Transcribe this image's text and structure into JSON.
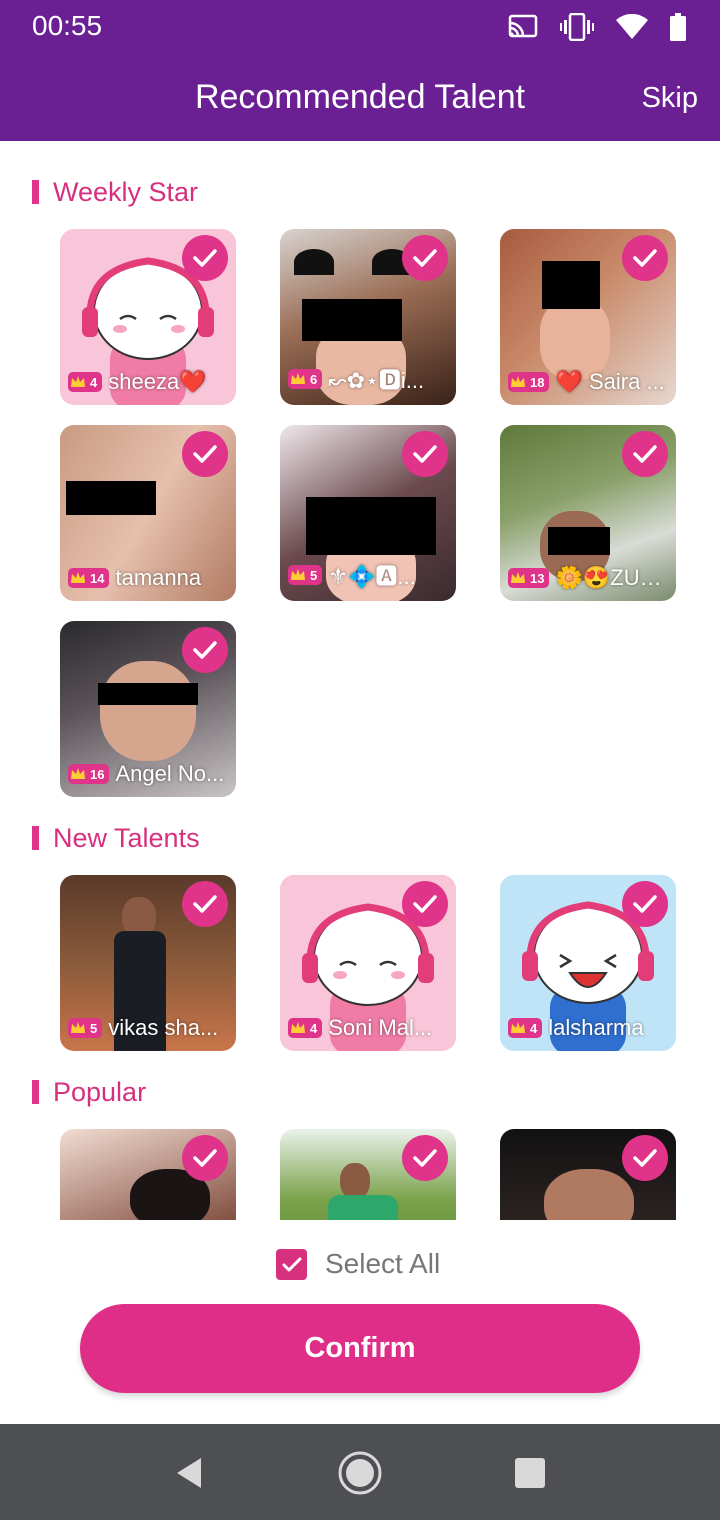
{
  "status": {
    "time": "00:55",
    "icons": [
      "cast-icon",
      "vibrate-icon",
      "wifi-icon",
      "battery-icon"
    ]
  },
  "header": {
    "title": "Recommended Talent",
    "skip": "Skip"
  },
  "sections": [
    {
      "title": "Weekly Star",
      "cards": [
        {
          "level": "4",
          "name": "sheeza❤️",
          "selected": true
        },
        {
          "level": "6",
          "name": "↜✿⋆🅳i...",
          "selected": true
        },
        {
          "level": "18",
          "name": "❤️ Saira ...",
          "selected": true
        },
        {
          "level": "14",
          "name": "tamanna",
          "selected": true
        },
        {
          "level": "5",
          "name": "⚜💠🅰...",
          "selected": true
        },
        {
          "level": "13",
          "name": "🌼😍ZUB...",
          "selected": true
        },
        {
          "level": "16",
          "name": "Angel No...",
          "selected": true
        }
      ]
    },
    {
      "title": "New Talents",
      "cards": [
        {
          "level": "5",
          "name": "vikas sha...",
          "selected": true
        },
        {
          "level": "4",
          "name": "Soni Mal...",
          "selected": true
        },
        {
          "level": "4",
          "name": "lalsharma",
          "selected": true
        }
      ]
    },
    {
      "title": "Popular",
      "cards": [
        {
          "selected": true
        },
        {
          "selected": true
        },
        {
          "selected": true
        }
      ]
    }
  ],
  "footer": {
    "select_all": "Select All",
    "select_all_checked": true,
    "confirm": "Confirm"
  },
  "colors": {
    "header_bg": "#6a1f93",
    "accent": "#e0338a",
    "nav_bg": "#4d4f53"
  }
}
